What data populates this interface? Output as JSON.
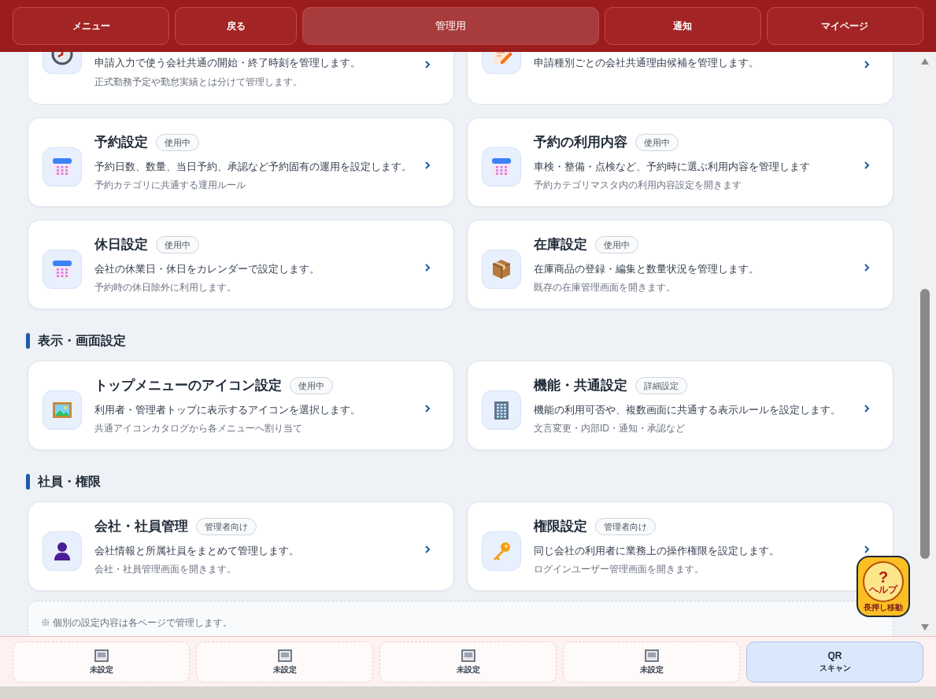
{
  "header": {
    "buttons": [
      {
        "label": "メニュー",
        "selected": false
      },
      {
        "label": "戻る",
        "selected": false
      },
      {
        "label": "管理用",
        "selected": true
      },
      {
        "label": "通知",
        "selected": false
      },
      {
        "label": "マイページ",
        "selected": false
      }
    ]
  },
  "sections": [
    {
      "cards": [
        {
          "description": "申請入力で使う会社共通の開始・終了時刻を管理します。",
          "note": "正式勤務予定や勤怠実績とは分けて管理します。"
        },
        {
          "description": "申請種別ごとの会社共通理由候補を管理します。"
        }
      ]
    },
    {
      "cards": [
        {
          "title": "予約設定",
          "badge": "使用中",
          "description": "予約日数、数量、当日予約、承認など予約固有の運用を設定します。",
          "note": "予約カテゴリに共通する運用ルール"
        },
        {
          "title": "予約の利用内容",
          "badge": "使用中",
          "description": "車検・整備・点検など、予約時に選ぶ利用内容を管理します",
          "note": "予約カテゴリマスタ内の利用内容設定を開きます"
        },
        {
          "title": "休日設定",
          "badge": "使用中",
          "description": "会社の休業日・休日をカレンダーで設定します。",
          "note": "予約時の休日除外に利用します。"
        },
        {
          "title": "在庫設定",
          "badge": "使用中",
          "description": "在庫商品の登録・編集と数量状況を管理します。",
          "note": "既存の在庫管理画面を開きます。"
        }
      ]
    },
    {
      "title": "表示・画面設定",
      "cards": [
        {
          "title": "トップメニューのアイコン設定",
          "badge": "使用中",
          "description": "利用者・管理者トップに表示するアイコンを選択します。",
          "note": "共通アイコンカタログから各メニューへ割り当て"
        },
        {
          "title": "機能・共通設定",
          "badge": "詳細設定",
          "description": "機能の利用可否や、複数画面に共通する表示ルールを設定します。",
          "note": "文言変更・内部ID・通知・承認など"
        }
      ]
    },
    {
      "title": "社員・権限",
      "cards": [
        {
          "title": "会社・社員管理",
          "badge": "管理者向け",
          "description": "会社情報と所属社員をまとめて管理します。",
          "note": "会社・社員管理画面を開きます。"
        },
        {
          "title": "権限設定",
          "badge": "管理者向け",
          "description": "同じ会社の利用者に業務上の操作権限を設定します。",
          "note": "ログインユーザー管理画面を開きます。"
        }
      ]
    }
  ],
  "footnote": "※ 個別の設定内容は各ページで管理します。",
  "help": {
    "symbol": "?",
    "label": "ヘルプ",
    "hint": "長押し移動"
  },
  "footer": {
    "buttons": [
      {
        "kind": "unset",
        "label": "未設定"
      },
      {
        "kind": "unset",
        "label": "未設定"
      },
      {
        "kind": "unset",
        "label": "未設定"
      },
      {
        "kind": "unset",
        "label": "未設定"
      },
      {
        "kind": "qr",
        "title": "QR",
        "label": "スキャン"
      }
    ]
  }
}
